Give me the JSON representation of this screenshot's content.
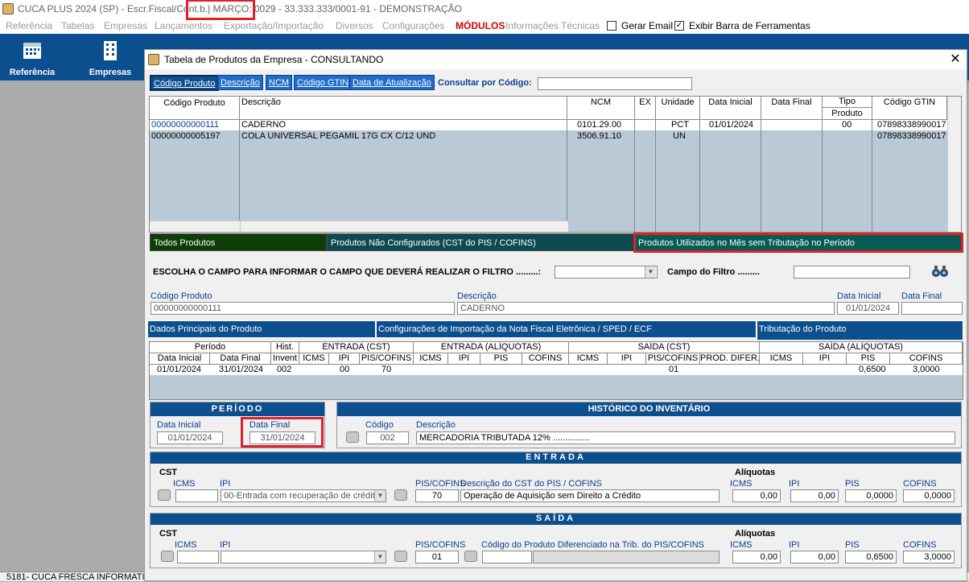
{
  "app": {
    "title": "CUCA PLUS 2024 (SP) - Escr.Fiscal/Cont.b.| MARÇO: 0029 - 33.333.333/0001-91 - DEMONSTRAÇÃO"
  },
  "menu": {
    "items": [
      "Referência",
      "Tabelas",
      "Empresas",
      "Lançamentos",
      "Exportação/Importação",
      "Diversos",
      "Configurações"
    ],
    "modules": "MÓDULOS",
    "tech": "Informações Técnicas",
    "gerar_email": "Gerar Email",
    "exibir_barra": "Exibir Barra de Ferramentas",
    "gerar_email_checked": false,
    "exibir_barra_checked": true,
    "check_mark": "✓"
  },
  "toolbar": {
    "referencia": "Referência",
    "empresas": "Empresas"
  },
  "statusbar": {
    "text": "5181- CUCA FRESCA INFORMATIC"
  },
  "window": {
    "title": "Tabela de Produtos da Empresa  -  CONSULTANDO",
    "close": "✕"
  },
  "search": {
    "tabs": [
      "Código Produto",
      "Descrição",
      "NCM",
      "Código GTIN",
      "Data de Atualização"
    ],
    "label": "Consultar por Código:",
    "value": ""
  },
  "products": {
    "headers": {
      "codigo": "Código Produto",
      "descricao": "Descrição",
      "ncm": "NCM",
      "ex": "EX",
      "unidade": "Unidade",
      "data_inicial": "Data Inicial",
      "data_final": "Data Final",
      "tipo": "Tipo",
      "produto": "Produto",
      "gtin": "Código GTIN"
    },
    "rows": [
      {
        "codigo": "00000000000111",
        "descricao": "CADERNO",
        "ncm": "0101.29.00",
        "ex": "",
        "unidade": "PCT",
        "data_inicial": "01/01/2024",
        "data_final": "",
        "tipo": "00",
        "gtin": "07898338990017"
      },
      {
        "codigo": "00000000005197",
        "descricao": "COLA UNIVERSAL PEGAMIL 17G CX C/12 UND",
        "ncm": "3506.91.10",
        "ex": "",
        "unidade": "UN",
        "data_inicial": "",
        "data_final": "",
        "tipo": "",
        "gtin": "07898338990017"
      }
    ]
  },
  "filters": {
    "todos": "Todos Produtos",
    "nao_config": "Produtos Não Configurados (CST do PIS / COFINS)",
    "utilizados": "Produtos Utilizados no Mês sem Tributação no Período"
  },
  "filter_field": {
    "label": "ESCOLHA O CAMPO PARA INFORMAR O CAMPO QUE DEVERÁ REALIZAR O FILTRO .........:",
    "campo_label": "Campo do Filtro .........",
    "select_value": "",
    "campo_value": ""
  },
  "detail": {
    "codigo_label": "Código Produto",
    "codigo": "00000000000111",
    "descricao_label": "Descrição",
    "descricao": "CADERNO",
    "data_inicial_label": "Data Inicial",
    "data_inicial": "01/01/2024",
    "data_final_label": "Data Final",
    "data_final": ""
  },
  "sections": {
    "dados": "Dados Principais do Produto",
    "config": "Configurações de Importação da Nota Fiscal Eletrônica / SPED / ECF",
    "trib": "Tributação do Produto"
  },
  "trib_grid": {
    "groups": {
      "periodo": "Período",
      "hist": "Hist.",
      "entrada_cst": "ENTRADA (CST)",
      "entrada_aliq": "ENTRADA (ALÍQUOTAS)",
      "saida_cst": "SAÍDA (CST)",
      "saida_aliq": "SAÍDA (ALÍQUOTAS)"
    },
    "cols": {
      "di": "Data Inicial",
      "df": "Data Final",
      "invent": "Invent",
      "icms": "ICMS",
      "ipi": "IPI",
      "piscofins": "PIS/COFINS",
      "pis": "PIS",
      "cofins": "COFINS",
      "prod_difer": "PROD. DIFER."
    },
    "row": {
      "di": "01/01/2024",
      "df": "31/01/2024",
      "hist": "002",
      "e_ipi": "00",
      "e_pis": "70",
      "s_pis": "01",
      "sa_pis": "0,6500",
      "sa_cofins": "3,0000"
    }
  },
  "periodo": {
    "title": "PERÍODO",
    "di_label": "Data Inicial",
    "di": "01/01/2024",
    "df_label": "Data Final",
    "df": "31/01/2024"
  },
  "historico": {
    "title": "HISTÓRICO DO INVENTÁRIO",
    "codigo_label": "Código",
    "codigo": "002",
    "descricao_label": "Descrição",
    "descricao": "MERCADORIA TRIBUTADA 12% ..............."
  },
  "entrada": {
    "title": "ENTRADA",
    "cst": "CST",
    "icms": "ICMS",
    "ipi": "IPI",
    "ipi_value": "00-Entrada com recuperação de crédito",
    "piscofins": "PIS/COFINS",
    "desc_label": "Descrição do CST do PIS / COFINS",
    "piscofins_value": "70",
    "desc_value": "Operação de Aquisição sem Direito a Crédito",
    "aliq": "Alíquotas",
    "aliq_icms": "ICMS",
    "aliq_ipi": "IPI",
    "aliq_pis": "PIS",
    "aliq_cofins": "COFINS",
    "v_icms": "0,00",
    "v_ipi": "0,00",
    "v_pis": "0,0000",
    "v_cofins": "0,0000"
  },
  "saida": {
    "title": "SAÍDA",
    "cst": "CST",
    "icms": "ICMS",
    "ipi": "IPI",
    "piscofins": "PIS/COFINS",
    "piscofins_value": "01",
    "cod_label": "Código do Produto Diferenciado na Trib. do PIS/COFINS",
    "aliq": "Alíquotas",
    "aliq_icms": "ICMS",
    "aliq_ipi": "IPI",
    "aliq_pis": "PIS",
    "aliq_cofins": "COFINS",
    "v_icms": "0,00",
    "v_ipi": "0,00",
    "v_pis": "0,6500",
    "v_cofins": "3,0000"
  },
  "colors": {
    "accent": "#0c4f8e",
    "tab": "#1e6dc8",
    "filter_green": "#0e3d08",
    "filter_teal": "#0b4a4f",
    "highlight": "#e0202a"
  }
}
